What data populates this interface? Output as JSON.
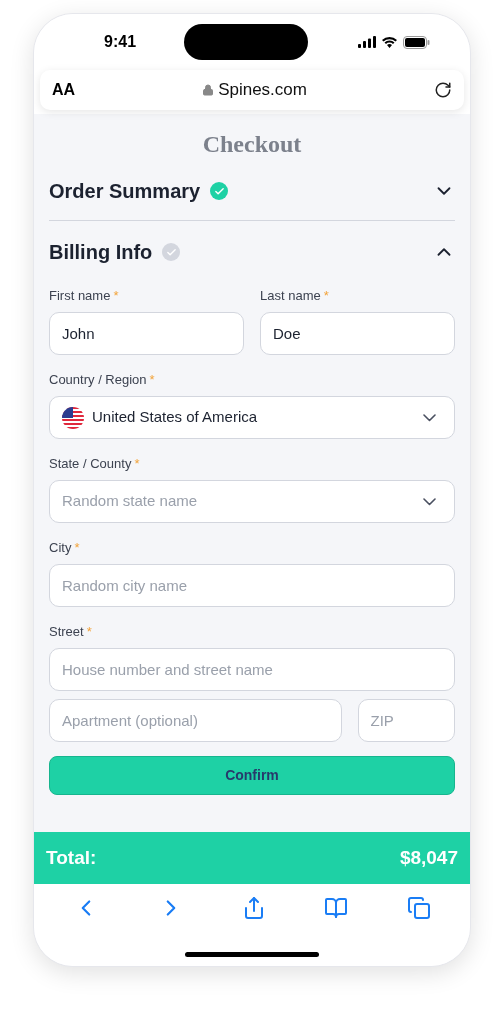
{
  "status_bar": {
    "time": "9:41"
  },
  "browser": {
    "text_size": "AA",
    "url": "Spines.com"
  },
  "page_title": "Checkout",
  "sections": [
    {
      "title": "Order Summary",
      "completed": true,
      "expanded": false
    },
    {
      "title": "Billing Info",
      "completed": false,
      "expanded": true
    }
  ],
  "form_rows": [
    [
      {
        "kind": "text",
        "label": "First name",
        "required_mark": "*",
        "value": "John"
      },
      {
        "kind": "text",
        "label": "Last name",
        "required_mark": "*",
        "value": "Doe"
      }
    ],
    [
      {
        "kind": "select",
        "label": "Country / Region",
        "required_mark": "*",
        "value": "United States of America",
        "flag": true
      }
    ],
    [
      {
        "kind": "select",
        "label": "State / County",
        "required_mark": "*",
        "placeholder": "Random state name"
      }
    ],
    [
      {
        "kind": "text",
        "label": "City",
        "required_mark": "*",
        "placeholder": "Random city name"
      }
    ],
    [
      {
        "kind": "text",
        "label": "Street",
        "required_mark": "*",
        "placeholder": "House number and street name"
      }
    ],
    [
      {
        "kind": "text",
        "placeholder": "Apartment (optional)",
        "grow": true
      },
      {
        "kind": "text",
        "placeholder": "ZIP"
      }
    ]
  ],
  "confirm_button": "Confirm",
  "total": {
    "label": "Total:",
    "amount": "$8,047"
  }
}
